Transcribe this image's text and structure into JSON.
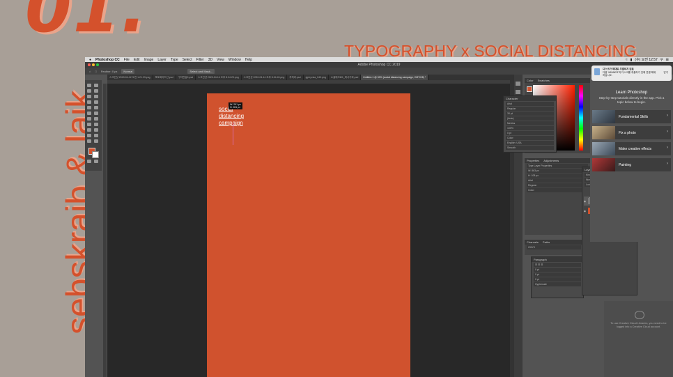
{
  "slide": {
    "number": "01.",
    "title": "TYPOGRAPHY x SOCIAL DISTANCING",
    "side_text": "sebskraib & laik"
  },
  "colors": {
    "accent": "#d4512c",
    "accent_light": "#e9a48b",
    "background": "#a89f97",
    "canvas_orange": "#d0522e"
  },
  "app": {
    "menu": [
      "Photoshop CC",
      "File",
      "Edit",
      "Image",
      "Layer",
      "Type",
      "Select",
      "Filter",
      "3D",
      "View",
      "Window",
      "Help"
    ],
    "clock": "(수) 오전 12:57",
    "window_title": "Adobe Photoshop CC 2019",
    "options": {
      "feather": "Feather: 0 px",
      "style": "Normal",
      "select_mask": "Select and Mask..."
    },
    "tabs": [
      "스크린샷 2020-04-12 오전 1.21.23.png",
      "포토와이드선.psd",
      "구이번입2.psd",
      "스크린샷 2020-04-14 오후 8.04.23.png",
      "스크린샷 2020-04-14 오후 8.04.43.png",
      "차치라.psd",
      "giphyvisa_043.png",
      "소셜매크로1_최사기와.psd",
      "Untitled-1 @ 50% (social distancing campaign, CMYK/8) *"
    ],
    "canvas_text": [
      "social",
      "distancing",
      "campaign"
    ],
    "tooltip": [
      "W: 291 px",
      "H: 281 px"
    ]
  },
  "panels": {
    "color_tabs": [
      "Color",
      "Swatches"
    ],
    "character": {
      "tab": "Character",
      "font": "Arial",
      "style": "Regular",
      "size": "30 pt",
      "leading": "(Auto)",
      "tracking": "Metrics",
      "kerning": "100",
      "scale": "100%",
      "baseline": "0 pt",
      "color_label": "Color:",
      "language": "English: USA",
      "aa": "Smooth"
    },
    "properties": {
      "tabs": [
        "Properties",
        "Adjustments"
      ],
      "section": "Type Layer Properties",
      "w": "W: 863 px",
      "h": "H: 108 px",
      "font": "Arial",
      "style": "Regular",
      "color_label": "Color:"
    },
    "channels_tabs": [
      "Channels",
      "Paths"
    ],
    "channel_item": "CMYK",
    "paragraph": {
      "tab": "Paragraph",
      "indent": "0 pt",
      "hyphenate": "Hyphenate"
    },
    "layers": {
      "tab": "Layers",
      "kind": "Kind",
      "blend": "Normal",
      "opacity": "Opacity: 100%",
      "fill": "Fill: 100%",
      "lock": "Lock:",
      "items": [
        "social distancing campaign",
        "Background"
      ]
    },
    "learn": {
      "title": "Learn Photoshop",
      "subtitle": "Step-by-step tutorials directly in the app. Pick a topic below to begin.",
      "items": [
        "Fundamental Skills",
        "Fix a photo",
        "Make creative effects",
        "Painting"
      ]
    },
    "notification": {
      "title": "디스크가 제대로 추출되지 않음",
      "body": "다음 'WINNER'의 디스크를 추출하기 전에 연결 해제하십시오.",
      "action": "닫기"
    },
    "cloud": {
      "message": "To use Creative Cloud Libraries, you need to be logged into a Creative Cloud account."
    }
  }
}
